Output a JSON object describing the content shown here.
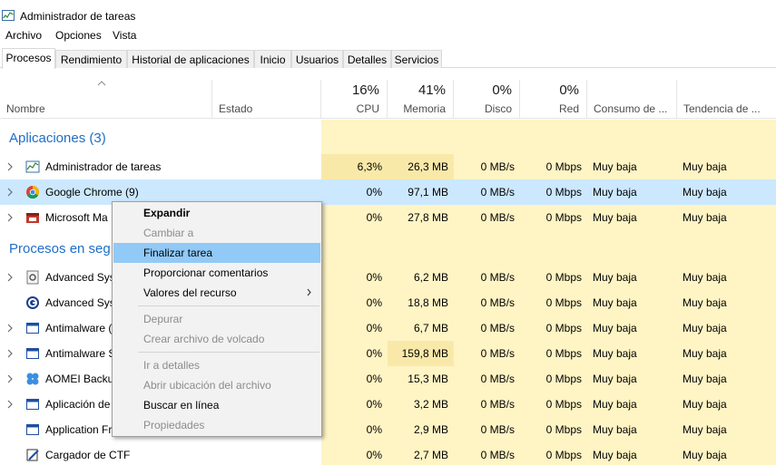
{
  "window": {
    "title": "Administrador de tareas"
  },
  "menu": [
    "Archivo",
    "Opciones",
    "Vista"
  ],
  "tabs": [
    "Procesos",
    "Rendimiento",
    "Historial de aplicaciones",
    "Inicio",
    "Usuarios",
    "Detalles",
    "Servicios"
  ],
  "active_tab": "Procesos",
  "columns": {
    "name": "Nombre",
    "status": "Estado",
    "cpu": {
      "pct": "16%",
      "label": "CPU"
    },
    "memory": {
      "pct": "41%",
      "label": "Memoria"
    },
    "disk": {
      "pct": "0%",
      "label": "Disco"
    },
    "network": {
      "pct": "0%",
      "label": "Red"
    },
    "power": "Consumo de ...",
    "power_trend": "Tendencia de ..."
  },
  "groups": {
    "apps": "Aplicaciones (3)",
    "background": "Procesos en seg"
  },
  "rows": [
    {
      "name": "Administrador de tareas",
      "cpu": "6,3%",
      "mem": "26,3 MB",
      "disk": "0 MB/s",
      "net": "0 Mbps",
      "power": "Muy baja",
      "trend": "Muy baja",
      "icon": "task-manager-icon"
    },
    {
      "name": "Google Chrome (9)",
      "cpu": "0%",
      "mem": "97,1 MB",
      "disk": "0 MB/s",
      "net": "0 Mbps",
      "power": "Muy baja",
      "trend": "Muy baja",
      "icon": "chrome-icon"
    },
    {
      "name": "Microsoft Ma",
      "cpu": "0%",
      "mem": "27,8 MB",
      "disk": "0 MB/s",
      "net": "0 Mbps",
      "power": "Muy baja",
      "trend": "Muy baja",
      "icon": "app-icon"
    },
    {
      "name": "Advanced Sys",
      "cpu": "0%",
      "mem": "6,2 MB",
      "disk": "0 MB/s",
      "net": "0 Mbps",
      "power": "Muy baja",
      "trend": "Muy baja",
      "icon": "service-icon"
    },
    {
      "name": "Advanced Sys",
      "cpu": "0%",
      "mem": "18,8 MB",
      "disk": "0 MB/s",
      "net": "0 Mbps",
      "power": "Muy baja",
      "trend": "Muy baja",
      "icon": "asc-icon"
    },
    {
      "name": "Antimalware (",
      "cpu": "0%",
      "mem": "6,7 MB",
      "disk": "0 MB/s",
      "net": "0 Mbps",
      "power": "Muy baja",
      "trend": "Muy baja",
      "icon": "window-icon"
    },
    {
      "name": "Antimalware S",
      "cpu": "0%",
      "mem": "159,8 MB",
      "disk": "0 MB/s",
      "net": "0 Mbps",
      "power": "Muy baja",
      "trend": "Muy baja",
      "icon": "window-icon"
    },
    {
      "name": "AOMEI Backu",
      "cpu": "0%",
      "mem": "15,3 MB",
      "disk": "0 MB/s",
      "net": "0 Mbps",
      "power": "Muy baja",
      "trend": "Muy baja",
      "icon": "aomei-icon"
    },
    {
      "name": "Aplicación de",
      "cpu": "0%",
      "mem": "3,2 MB",
      "disk": "0 MB/s",
      "net": "0 Mbps",
      "power": "Muy baja",
      "trend": "Muy baja",
      "icon": "window-icon"
    },
    {
      "name": "Application Fr",
      "cpu": "0%",
      "mem": "2,9 MB",
      "disk": "0 MB/s",
      "net": "0 Mbps",
      "power": "Muy baja",
      "trend": "Muy baja",
      "icon": "window-icon"
    },
    {
      "name": "Cargador de CTF",
      "cpu": "0%",
      "mem": "2,7 MB",
      "disk": "0 MB/s",
      "net": "0 Mbps",
      "power": "Muy baja",
      "trend": "Muy baja",
      "icon": "ctf-icon"
    }
  ],
  "context_menu": [
    {
      "label": "Expandir",
      "state": "bold"
    },
    {
      "label": "Cambiar a",
      "state": "disabled"
    },
    {
      "label": "Finalizar tarea",
      "state": "hover"
    },
    {
      "label": "Proporcionar comentarios",
      "state": "normal"
    },
    {
      "label": "Valores del recurso",
      "state": "submenu"
    },
    {
      "label": "Depurar",
      "state": "disabled"
    },
    {
      "label": "Crear archivo de volcado",
      "state": "disabled"
    },
    {
      "label": "Ir a detalles",
      "state": "disabled"
    },
    {
      "label": "Abrir ubicación del archivo",
      "state": "disabled"
    },
    {
      "label": "Buscar en línea",
      "state": "normal"
    },
    {
      "label": "Propiedades",
      "state": "disabled"
    }
  ],
  "colors": {
    "group_text": "#1e6ec8",
    "selection": "#cce8ff",
    "menu_hover": "#91c9f7",
    "heat_light": "#fff4c4",
    "heat_mid": "#f9e9a9"
  }
}
